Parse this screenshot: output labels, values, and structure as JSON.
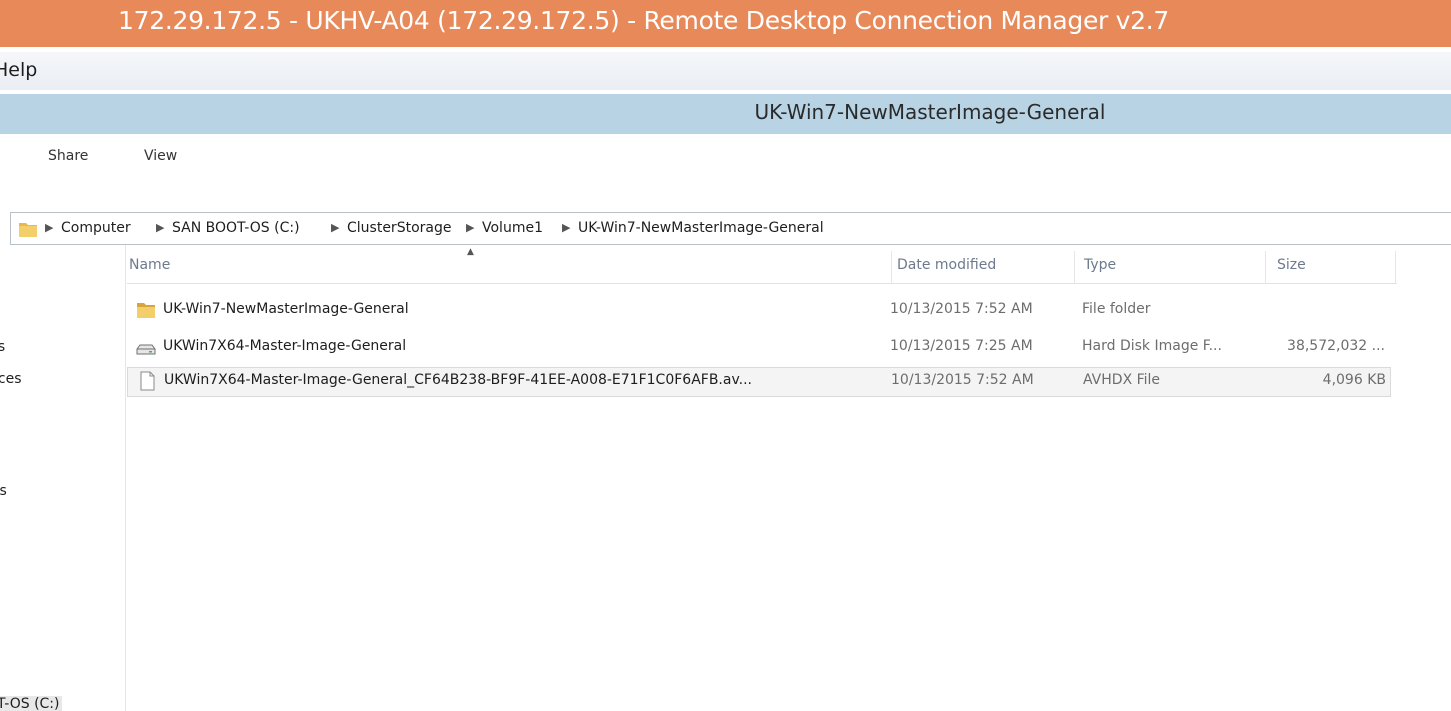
{
  "rdcman": {
    "title": "172.29.172.5 - UKHV-A04 (172.29.172.5) - Remote Desktop Connection Manager v2.7",
    "menu_help": "Help"
  },
  "explorer": {
    "window_title": "UK-Win7-NewMasterImage-General",
    "ribbon_tabs": {
      "share": "Share",
      "view": "View"
    },
    "breadcrumb": [
      "Computer",
      "SAN BOOT-OS (C:)",
      "ClusterStorage",
      "Volume1",
      "UK-Win7-NewMasterImage-General"
    ],
    "nav_pane": [
      "ls",
      "ices",
      "ts",
      "T-OS (C:)"
    ],
    "columns": {
      "name": "Name",
      "date": "Date modified",
      "type": "Type",
      "size": "Size"
    },
    "files": [
      {
        "icon": "folder-icon",
        "name": "UK-Win7-NewMasterImage-General",
        "date": "10/13/2015 7:52 AM",
        "type": "File folder",
        "size": ""
      },
      {
        "icon": "disk-image-icon",
        "name": "UKWin7X64-Master-Image-General",
        "date": "10/13/2015 7:25 AM",
        "type": "Hard Disk Image F...",
        "size": "38,572,032 ..."
      },
      {
        "icon": "file-icon",
        "name": "UKWin7X64-Master-Image-General_CF64B238-BF9F-41EE-A008-E71F1C0F6AFB.av...",
        "date": "10/13/2015 7:52 AM",
        "type": "AVHDX File",
        "size": "4,096 KB"
      }
    ]
  },
  "colors": {
    "rdc_title_bar": "#e8895a",
    "explorer_title_bar": "#b8d3e3",
    "folder_yellow": "#e8b84a"
  }
}
